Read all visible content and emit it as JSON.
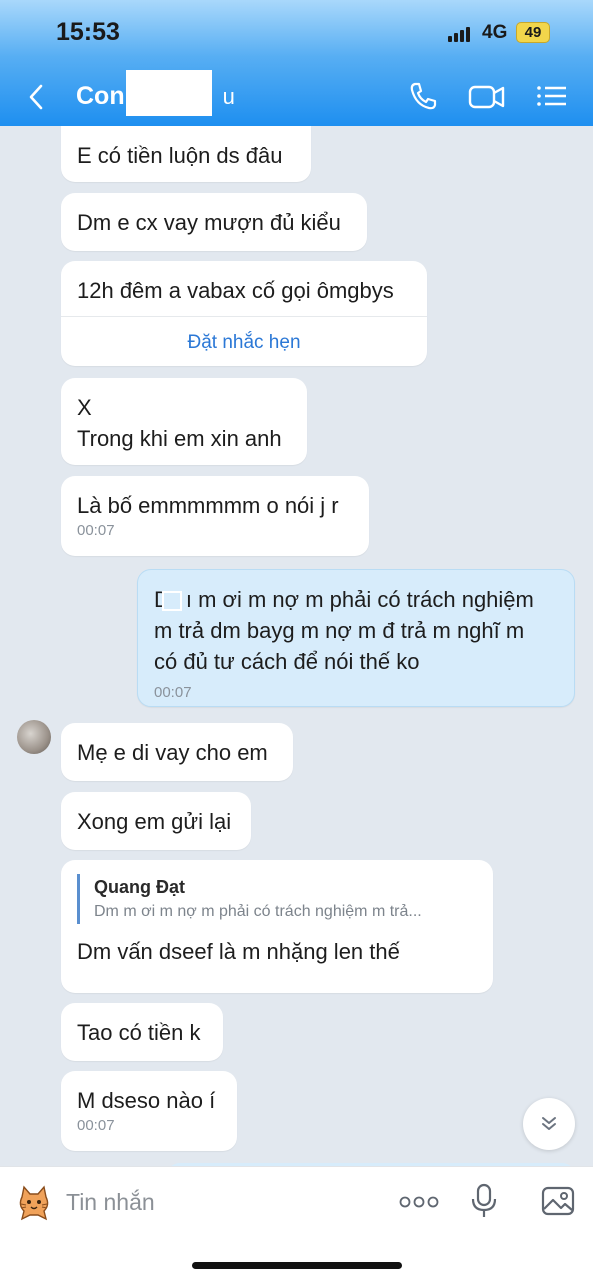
{
  "status_bar": {
    "time": "15:53",
    "network": "4G",
    "battery": "49"
  },
  "header": {
    "title": "Con",
    "title_suffix": "u",
    "back_icon": "chevron-left-icon",
    "call_icon": "phone-icon",
    "video_icon": "video-camera-icon",
    "menu_icon": "list-menu-icon",
    "gradient_top": "#a9d8fb",
    "gradient_bottom": "#1e8ff0"
  },
  "messages": [
    {
      "text": "E có tiền luộn ds đâu"
    },
    {
      "text": "Dm e cx vay mượn đủ kiểu"
    },
    {
      "text": "12h đêm a vabax cố gọi ômgbys",
      "action": "Đặt nhắc hẹn"
    },
    {
      "line1": "X",
      "line2": "Trong khi em xin anh"
    },
    {
      "text": "Là bố emmmmmm o nói j r",
      "time": "00:07"
    },
    {
      "sent": true,
      "prefix": "D",
      "line1": "ı m ơi m nợ m phải có trách nghiệm",
      "line2": "m trả dm bayg m nợ m đ trả m nghĩ m",
      "line3": "có đủ tư cách để nói thế ko",
      "time": "00:07"
    },
    {
      "text": "Mẹ e di vay cho em"
    },
    {
      "text": "Xong em gửi lại"
    },
    {
      "quote_name": "Quang Đạt",
      "quote_text": "Dm m ơi m nợ m phải có trách nghiệm m trả...",
      "text": "Dm vấn dseef là m nhặng len thế"
    },
    {
      "text": "Tao có tiền k"
    },
    {
      "text": "M dseso nào í",
      "time": "00:07"
    }
  ],
  "scroll_icon": "double-chevron-down-icon",
  "composer": {
    "placeholder": "Tin nhắn",
    "sticker_icon": "cat-sticker-icon",
    "more_icon": "more-dots-icon",
    "mic_icon": "microphone-icon",
    "image_icon": "image-icon"
  },
  "colors": {
    "chat_background": "#e2e8ef",
    "sent_bubble": "#d7ecfb",
    "received_bubble": "#ffffff",
    "link": "#2b78d6"
  }
}
